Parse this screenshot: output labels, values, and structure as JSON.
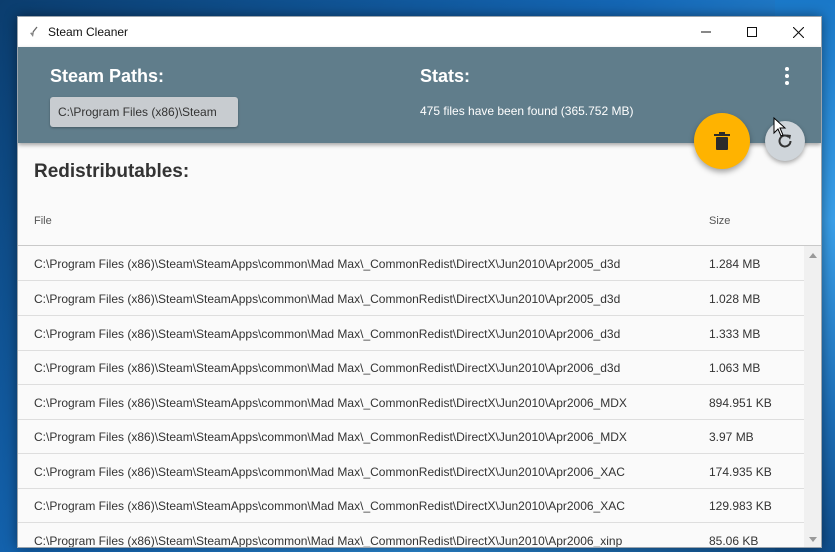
{
  "window": {
    "title": "Steam Cleaner"
  },
  "header": {
    "paths_label": "Steam Paths:",
    "path_value": "C:\\Program Files (x86)\\Steam",
    "stats_label": "Stats:",
    "stats_text": "475 files have been found (365.752 MB)"
  },
  "section": {
    "title": "Redistributables:"
  },
  "table": {
    "columns": {
      "file": "File",
      "size": "Size"
    },
    "rows": [
      {
        "file": "C:\\Program Files (x86)\\Steam\\SteamApps\\common\\Mad Max\\_CommonRedist\\DirectX\\Jun2010\\Apr2005_d3d",
        "size": "1.284 MB"
      },
      {
        "file": "C:\\Program Files (x86)\\Steam\\SteamApps\\common\\Mad Max\\_CommonRedist\\DirectX\\Jun2010\\Apr2005_d3d",
        "size": "1.028 MB"
      },
      {
        "file": "C:\\Program Files (x86)\\Steam\\SteamApps\\common\\Mad Max\\_CommonRedist\\DirectX\\Jun2010\\Apr2006_d3d",
        "size": "1.333 MB"
      },
      {
        "file": "C:\\Program Files (x86)\\Steam\\SteamApps\\common\\Mad Max\\_CommonRedist\\DirectX\\Jun2010\\Apr2006_d3d",
        "size": "1.063 MB"
      },
      {
        "file": "C:\\Program Files (x86)\\Steam\\SteamApps\\common\\Mad Max\\_CommonRedist\\DirectX\\Jun2010\\Apr2006_MDX",
        "size": "894.951 KB"
      },
      {
        "file": "C:\\Program Files (x86)\\Steam\\SteamApps\\common\\Mad Max\\_CommonRedist\\DirectX\\Jun2010\\Apr2006_MDX",
        "size": "3.97 MB"
      },
      {
        "file": "C:\\Program Files (x86)\\Steam\\SteamApps\\common\\Mad Max\\_CommonRedist\\DirectX\\Jun2010\\Apr2006_XAC",
        "size": "174.935 KB"
      },
      {
        "file": "C:\\Program Files (x86)\\Steam\\SteamApps\\common\\Mad Max\\_CommonRedist\\DirectX\\Jun2010\\Apr2006_XAC",
        "size": "129.983 KB"
      },
      {
        "file": "C:\\Program Files (x86)\\Steam\\SteamApps\\common\\Mad Max\\_CommonRedist\\DirectX\\Jun2010\\Apr2006_xinp",
        "size": "85.06 KB"
      }
    ]
  },
  "icons": {
    "app": "broom-icon",
    "minimize": "minimize-icon",
    "maximize": "maximize-icon",
    "close": "close-icon",
    "more": "more-vertical-icon",
    "delete": "trash-icon",
    "refresh": "refresh-icon"
  },
  "colors": {
    "header": "#607d8b",
    "delete_fab": "#ffb300",
    "refresh_fab": "#cfd5da"
  }
}
